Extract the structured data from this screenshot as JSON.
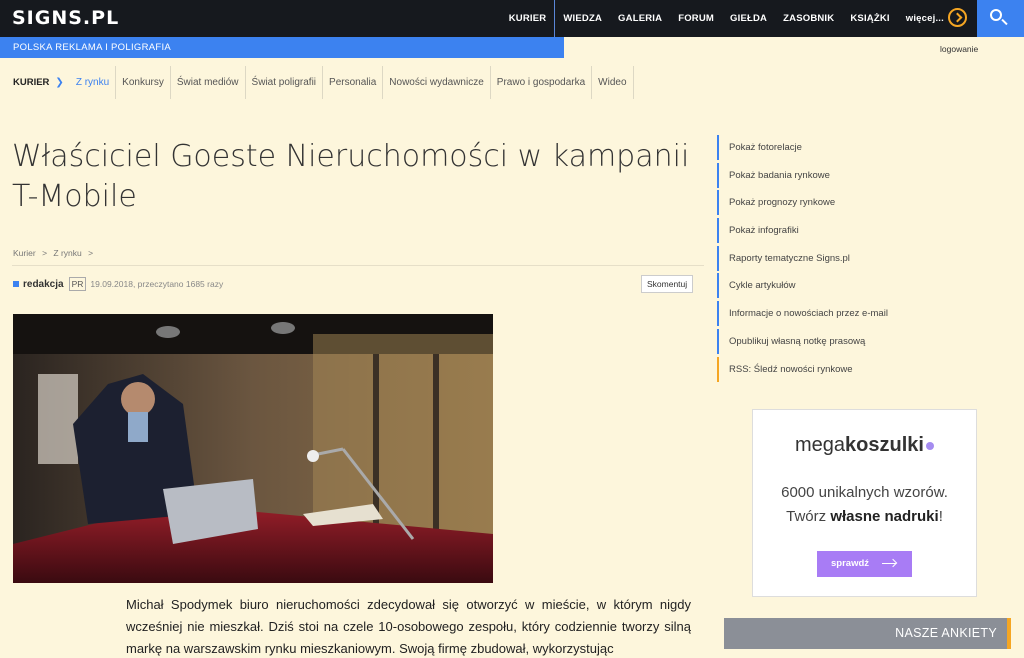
{
  "header": {
    "logo": "SIGNS.PL",
    "nav": [
      "KURIER",
      "WIEDZA",
      "GALERIA",
      "FORUM",
      "GIEŁDA",
      "ZASOBNIK",
      "KSIĄŻKI",
      "więcej..."
    ],
    "tagline": "POLSKA REKLAMA I POLIGRAFIA",
    "login": "logowanie"
  },
  "subnav": {
    "section": "KURIER",
    "items": [
      "Z rynku",
      "Konkursy",
      "Świat mediów",
      "Świat poligrafii",
      "Personalia",
      "Nowości wydawnicze",
      "Prawo i gospodarka",
      "Wideo"
    ]
  },
  "article": {
    "title": "Właściciel Goeste Nieruchomości w kampanii T-Mobile",
    "breadcrumb": [
      "Kurier",
      ">",
      "Z rynku",
      ">"
    ],
    "author": "redakcja",
    "pr_badge": "PR",
    "meta": "19.09.2018, przeczytano 1685 razy",
    "comment_label": "Skomentuj",
    "lead": "Michał Spodymek biuro nieruchomości zdecydował się otworzyć w mieście, w którym nigdy wcześniej nie mieszkał. Dziś stoi na czele 10-osobowego zespołu, który codziennie tworzy silną markę na warszawskim rynku mieszkaniowym. Swoją firmę zbudował, wykorzystując"
  },
  "sidebar": {
    "links": [
      "Pokaż fotorelacje",
      "Pokaż badania rynkowe",
      "Pokaż prognozy rynkowe",
      "Pokaż infografiki",
      "Raporty tematyczne Signs.pl",
      "Cykle artykułów",
      "Informacje o nowościach przez e-mail",
      "Opublikuj własną notkę prasową",
      "RSS: Śledź nowości rynkowe"
    ],
    "ad": {
      "brand_a": "mega",
      "brand_b": "koszulki",
      "line1": "6000 unikalnych wzorów.",
      "line2_a": "Twórz ",
      "line2_b": "własne nadruki",
      "line2_c": "!",
      "button": "sprawdź"
    },
    "polls": "NASZE ANKIETY"
  },
  "colors": {
    "accent": "#3c82f0",
    "orange": "#f5a623",
    "background": "#fdf6dc",
    "topbar": "#16191e"
  }
}
